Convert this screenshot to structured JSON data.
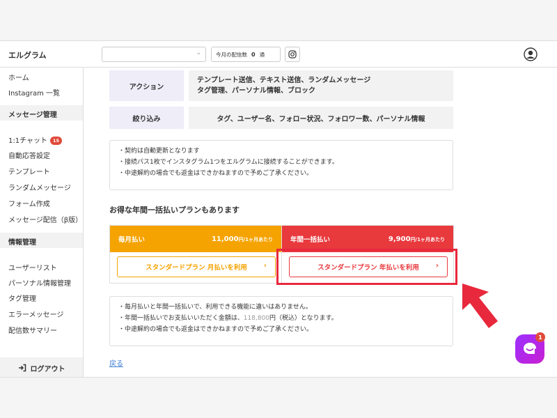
{
  "header": {
    "app_title": "エルグラム",
    "account_select_value": "",
    "delivery_label": "今月の配信数",
    "delivery_count": "0",
    "delivery_unit": "通"
  },
  "sidebar": {
    "items_top": [
      "ホーム",
      "Instagram 一覧"
    ],
    "section_message": "メッセージ管理",
    "chat_label": "1:1チャット",
    "chat_badge": "15",
    "message_items": [
      "自動応答設定",
      "テンプレート",
      "ランダムメッセージ",
      "フォーム作成",
      "メッセージ配信（β版）"
    ],
    "section_info": "情報管理",
    "info_items": [
      "ユーザーリスト",
      "パーソナル情報管理",
      "タグ管理",
      "エラーメッセージ",
      "配信数サマリー"
    ],
    "logout": "ログアウト"
  },
  "features": {
    "action_label": "アクション",
    "action_value_line1": "テンプレート送信、テキスト送信、ランダムメッセージ",
    "action_value_line2": "タグ管理、パーソナル情報、ブロック",
    "filter_label": "絞り込み",
    "filter_value": "タグ、ユーザー名、フォロー状況、フォロワー数、パーソナル情報"
  },
  "notes1": [
    "・契約は自動更新となります",
    "・接続パス1枚でインスタグラム1つをエルグラムに接続することができます。",
    "・中途解約の場合でも返金はできかねますので予めご了承ください。"
  ],
  "promo_title": "お得な年間一括払いプランもあります",
  "plans": {
    "monthly_name": "毎月払い",
    "monthly_price": "11,000",
    "monthly_unit": "円/1ヶ月あたり",
    "monthly_button": "スタンダードプラン 月払いを利用",
    "yearly_name": "年間一括払い",
    "yearly_price": "9,900",
    "yearly_unit": "円/1ヶ月あたり",
    "yearly_button": "スタンダードプラン 年払いを利用",
    "monthly_color": "#f5a300",
    "yearly_color": "#e8393d"
  },
  "notes2": {
    "line1": "・毎月払いと年間一括払いで、利用できる機能に違いはありません。",
    "line2_pre": "・年間一括払いでお支払いいただく金額は、",
    "line2_amount": "118,800",
    "line2_post": "円（税込）となります。",
    "line3": "・中途解約の場合でも返金はできかねますので予めご了承ください。"
  },
  "back_link": "戻る",
  "chat_fab_badge": "1",
  "button_arrow": "›"
}
